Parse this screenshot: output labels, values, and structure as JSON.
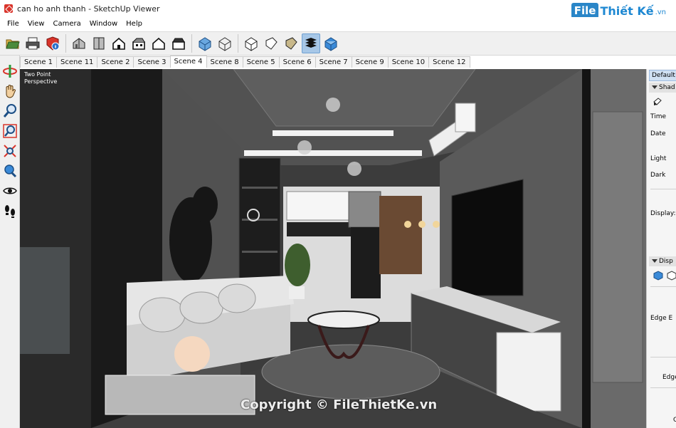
{
  "window": {
    "title": "can ho anh thanh - SketchUp Viewer"
  },
  "brand": {
    "box": "File",
    "text": "Thiết Kế",
    "sub": ".vn"
  },
  "menu": [
    "File",
    "View",
    "Camera",
    "Window",
    "Help"
  ],
  "toolbar": {
    "groups": [
      [
        "open-icon",
        "print-icon",
        "model-info-icon"
      ],
      [
        "iso-view-icon",
        "top-view-icon",
        "front-view-icon",
        "right-view-icon",
        "back-view-icon",
        "left-view-icon"
      ],
      [
        "xray-icon",
        "wireframe-icon",
        "hidden-line-icon",
        "shaded-icon",
        "shaded-textures-icon",
        "monochrome-icon"
      ]
    ],
    "active": "shaded-textures-icon"
  },
  "tabs": [
    "Scene 1",
    "Scene 11",
    "Scene 2",
    "Scene 3",
    "Scene 4",
    "Scene 8",
    "Scene 5",
    "Scene 6",
    "Scene 7",
    "Scene 9",
    "Scene 10",
    "Scene 12"
  ],
  "active_tab": "Scene 4",
  "left_tools": [
    "orbit-icon",
    "pan-icon",
    "zoom-icon",
    "zoom-window-icon",
    "zoom-extents-icon",
    "position-camera-icon",
    "look-around-icon",
    "walk-icon"
  ],
  "viewport": {
    "camera_label_line1": "Two Point",
    "camera_label_line2": "Perspective",
    "watermark": "Copyright © FileThietKe.vn"
  },
  "right_panel": {
    "header": "Default T",
    "shadows_section": "Shad",
    "time_label": "Time",
    "date_label": "Date",
    "light_label": "Light",
    "dark_label": "Dark",
    "display_label": "Display:",
    "styles_section": "Disp",
    "edge_label_1": "Edge E",
    "edge_label_2": "Edge",
    "last_label": "Q"
  },
  "colors": {
    "accent": "#2a86c8",
    "active_button": "#a7c7e7",
    "panel": "#f0f0f0"
  }
}
